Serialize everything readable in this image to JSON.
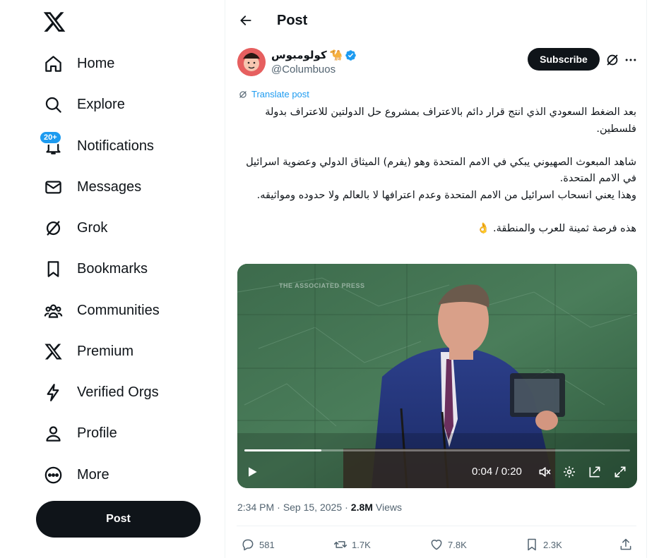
{
  "nav": {
    "items": [
      {
        "label": "Home",
        "icon": "home-icon"
      },
      {
        "label": "Explore",
        "icon": "search-icon"
      },
      {
        "label": "Notifications",
        "icon": "bell-icon",
        "badge": "20+"
      },
      {
        "label": "Messages",
        "icon": "envelope-icon"
      },
      {
        "label": "Grok",
        "icon": "grok-icon"
      },
      {
        "label": "Bookmarks",
        "icon": "bookmark-icon"
      },
      {
        "label": "Communities",
        "icon": "people-icon"
      },
      {
        "label": "Premium",
        "icon": "x-logo-icon"
      },
      {
        "label": "Verified Orgs",
        "icon": "lightning-icon"
      },
      {
        "label": "Profile",
        "icon": "person-icon"
      },
      {
        "label": "More",
        "icon": "more-circle-icon"
      }
    ],
    "post_button": "Post"
  },
  "header": {
    "title": "Post"
  },
  "author": {
    "name": "كولومبوس",
    "emoji": "🐪",
    "handle": "@Columbuos",
    "verified": true
  },
  "subscribe_label": "Subscribe",
  "translate_label": "Translate post",
  "tweet": {
    "paragraphs": [
      "بعد الضغط السعودي الذي انتج قرار دائم بالاعتراف بمشروع حل الدولتين للاعتراف بدولة فلسطين.",
      "",
      "شاهد المبعوث الصهيوني يبكي في الامم المتحدة وهو (يفرم) الميثاق الدولي وعضوية اسرائيل في الامم المتحدة.",
      "وهذا يعني انسحاب اسرائيل من الامم المتحدة وعدم اعترافها لا بالعالم ولا حدوده ومواثيقه.",
      "",
      "هذه فرصة ثمينة للعرب والمنطقة. 👌"
    ]
  },
  "video": {
    "watermark": "THE ASSOCIATED PRESS",
    "time_display": "0:04 / 0:20",
    "progress": 0.2
  },
  "meta": {
    "time": "2:34 PM",
    "date": "Sep 15, 2025",
    "views_count": "2.8M",
    "views_label": "Views"
  },
  "actions": {
    "replies": "581",
    "reposts": "1.7K",
    "likes": "7.8K",
    "bookmarks": "2.3K"
  },
  "colors": {
    "accent": "#1d9bf0",
    "text": "#0f1419",
    "secondary": "#536471",
    "button_dark": "#0f1419"
  }
}
